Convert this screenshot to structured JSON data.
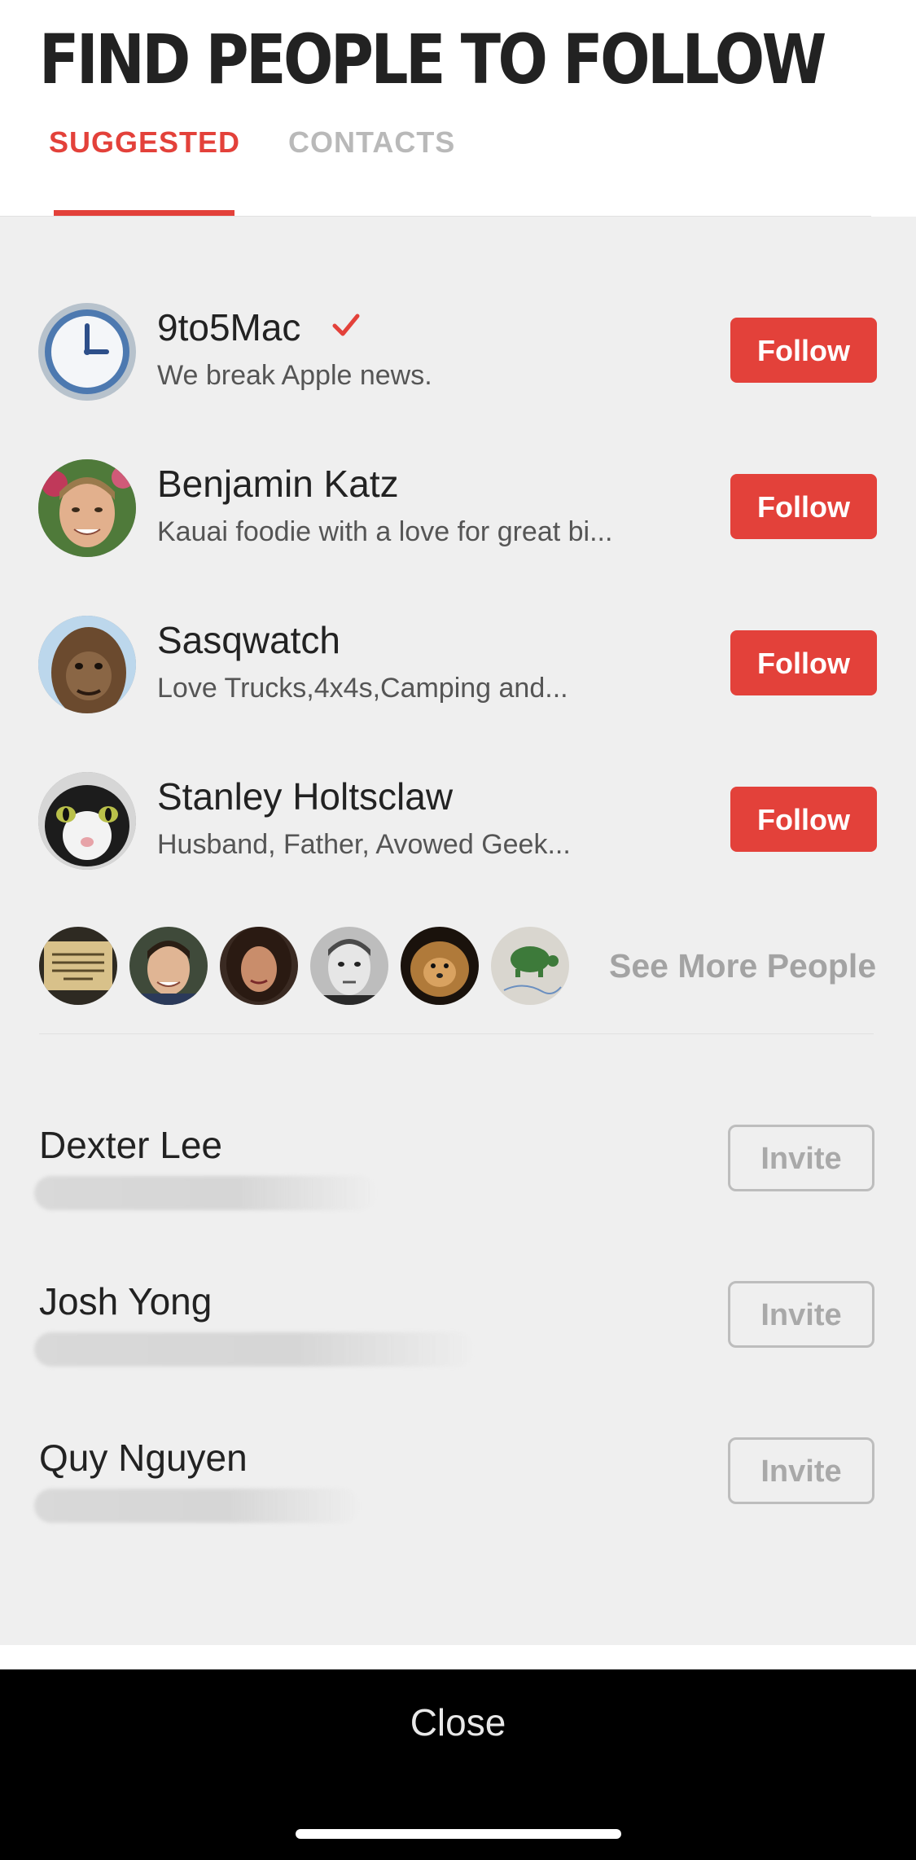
{
  "header": {
    "title": "FIND PEOPLE TO FOLLOW",
    "tabs": [
      {
        "label": "SUGGESTED",
        "active": true
      },
      {
        "label": "CONTACTS",
        "active": false
      }
    ]
  },
  "suggested": [
    {
      "name": "9to5Mac",
      "bio": "We break Apple news.",
      "verified": true,
      "button": "Follow",
      "avatar": "clock-avatar"
    },
    {
      "name": "Benjamin Katz",
      "bio": "Kauai foodie with a love for great bi...",
      "verified": false,
      "button": "Follow",
      "avatar": "person-avatar"
    },
    {
      "name": "Sasqwatch",
      "bio": "Love Trucks,4x4s,Camping and...",
      "verified": false,
      "button": "Follow",
      "avatar": "bigfoot-avatar"
    },
    {
      "name": "Stanley Holtsclaw",
      "bio": "Husband, Father, Avowed Geek...",
      "verified": false,
      "button": "Follow",
      "avatar": "cat-avatar"
    }
  ],
  "more_people": {
    "label": "See More People",
    "avatars": [
      {
        "avatar": "sign-avatar",
        "text": "THE GIBRALTAR TOURIST BOARD RE-ENACTMENT GROUP"
      },
      {
        "avatar": "man-avatar"
      },
      {
        "avatar": "woman-avatar"
      },
      {
        "avatar": "vintage-portrait-avatar"
      },
      {
        "avatar": "dog-avatar"
      },
      {
        "avatar": "turtle-drawing-avatar"
      }
    ]
  },
  "contacts": [
    {
      "name": "Dexter Lee",
      "button": "Invite"
    },
    {
      "name": "Josh Yong",
      "button": "Invite"
    },
    {
      "name": "Quy Nguyen",
      "button": "Invite"
    }
  ],
  "footer": {
    "close_label": "Close"
  },
  "colors": {
    "accent": "#e3413a",
    "background": "#efefef",
    "footer": "#000000"
  }
}
